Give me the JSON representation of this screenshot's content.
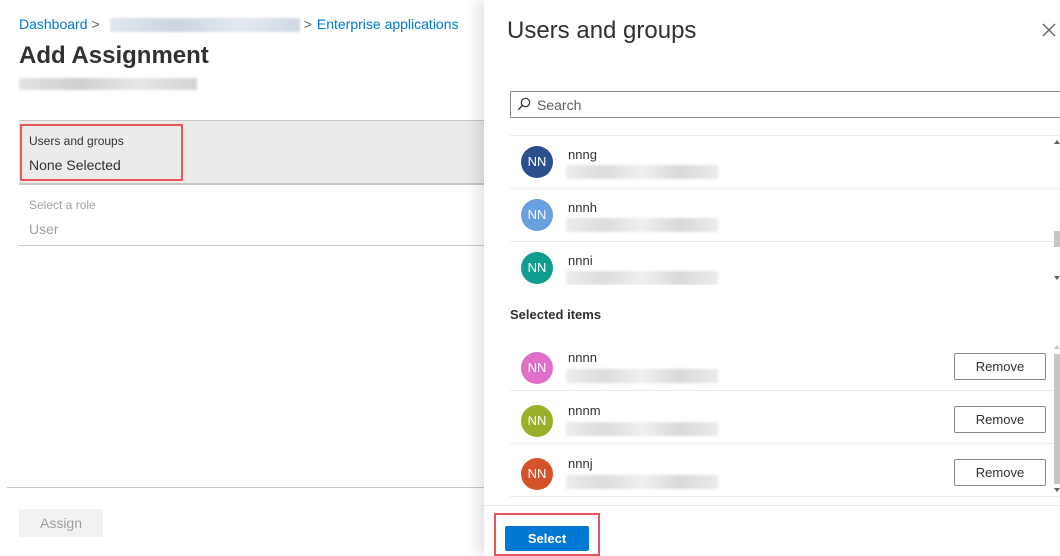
{
  "breadcrumb": {
    "home": "Dashboard",
    "separator": ">",
    "current": "Enterprise applications"
  },
  "page": {
    "title": "Add Assignment"
  },
  "assignment_form": {
    "users_label": "Users and groups",
    "users_value": "None Selected",
    "role_label": "Select a role",
    "role_value": "User",
    "assign_label": "Assign"
  },
  "panel": {
    "title": "Users and groups",
    "close_icon": "close-icon",
    "search_placeholder": "Search",
    "search_icon": "search-icon",
    "results": [
      {
        "initials": "NN",
        "name": "nnng",
        "color": "#2b4f8c"
      },
      {
        "initials": "NN",
        "name": "nnnh",
        "color": "#6aa0e0"
      },
      {
        "initials": "NN",
        "name": "nnni",
        "color": "#0e9d8f"
      }
    ],
    "selected_title": "Selected items",
    "selected": [
      {
        "initials": "NN",
        "name": "nnnn",
        "color": "#df6fc8",
        "remove_label": "Remove"
      },
      {
        "initials": "NN",
        "name": "nnnm",
        "color": "#98b02a",
        "remove_label": "Remove"
      },
      {
        "initials": "NN",
        "name": "nnnj",
        "color": "#d5532a",
        "remove_label": "Remove"
      }
    ],
    "select_label": "Select"
  },
  "colors": {
    "accent": "#0078d4",
    "highlight": "#e8565b"
  }
}
